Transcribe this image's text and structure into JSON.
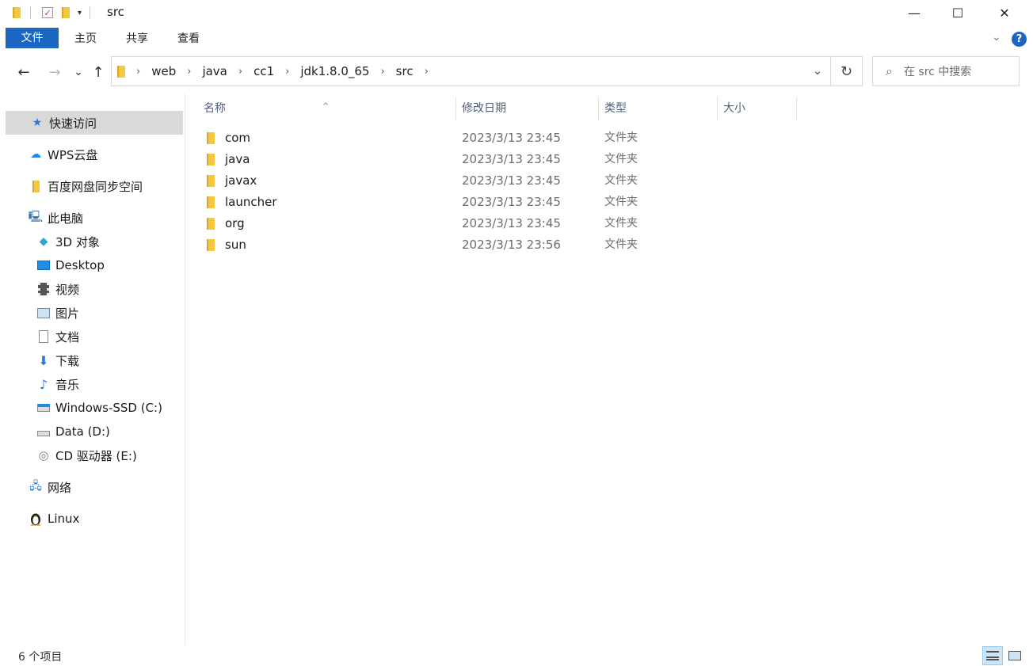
{
  "window": {
    "title": "src",
    "controls": {
      "minimize": "—",
      "maximize": "☐",
      "close": "✕"
    }
  },
  "ribbon": {
    "tabs": [
      "文件",
      "主页",
      "共享",
      "查看"
    ],
    "help": "?",
    "collapse_icon": "chevron-down"
  },
  "navigation": {
    "back": "←",
    "forward": "→",
    "recent": "⌄",
    "up": "↑",
    "breadcrumb": [
      "web",
      "java",
      "cc1",
      "jdk1.8.0_65",
      "src"
    ],
    "separator": "›",
    "refresh": "↻",
    "search_placeholder": "在 src 中搜索"
  },
  "sidebar": {
    "items": [
      {
        "label": "快速访问",
        "icon": "star-icon",
        "level": 0,
        "selected": true
      },
      {
        "label": "WPS云盘",
        "icon": "cloud-icon",
        "level": 0
      },
      {
        "label": "百度网盘同步空间",
        "icon": "folder-icon",
        "level": 0
      },
      {
        "label": "此电脑",
        "icon": "computer-icon",
        "level": 0
      },
      {
        "label": "3D 对象",
        "icon": "cube-icon",
        "level": 1
      },
      {
        "label": "Desktop",
        "icon": "desktop-icon",
        "level": 1
      },
      {
        "label": "视频",
        "icon": "video-icon",
        "level": 1
      },
      {
        "label": "图片",
        "icon": "picture-icon",
        "level": 1
      },
      {
        "label": "文档",
        "icon": "document-icon",
        "level": 1
      },
      {
        "label": "下载",
        "icon": "download-icon",
        "level": 1
      },
      {
        "label": "音乐",
        "icon": "music-icon",
        "level": 1
      },
      {
        "label": "Windows-SSD (C:)",
        "icon": "windows-drive-icon",
        "level": 1
      },
      {
        "label": "Data (D:)",
        "icon": "drive-icon",
        "level": 1
      },
      {
        "label": "CD 驱动器 (E:)",
        "icon": "cd-drive-icon",
        "level": 1
      },
      {
        "label": "网络",
        "icon": "network-icon",
        "level": 0
      },
      {
        "label": "Linux",
        "icon": "linux-penguin-icon",
        "level": 0
      }
    ]
  },
  "columns": {
    "name": "名称",
    "modified": "修改日期",
    "type": "类型",
    "size": "大小"
  },
  "files": [
    {
      "name": "com",
      "modified": "2023/3/13 23:45",
      "type": "文件夹"
    },
    {
      "name": "java",
      "modified": "2023/3/13 23:45",
      "type": "文件夹"
    },
    {
      "name": "javax",
      "modified": "2023/3/13 23:45",
      "type": "文件夹"
    },
    {
      "name": "launcher",
      "modified": "2023/3/13 23:45",
      "type": "文件夹"
    },
    {
      "name": "org",
      "modified": "2023/3/13 23:45",
      "type": "文件夹"
    },
    {
      "name": "sun",
      "modified": "2023/3/13 23:56",
      "type": "文件夹"
    }
  ],
  "status": {
    "item_count": "6 个项目"
  },
  "colors": {
    "accent": "#1a66c0",
    "folder": "#f5c842",
    "selection": "#d9d9d9"
  }
}
